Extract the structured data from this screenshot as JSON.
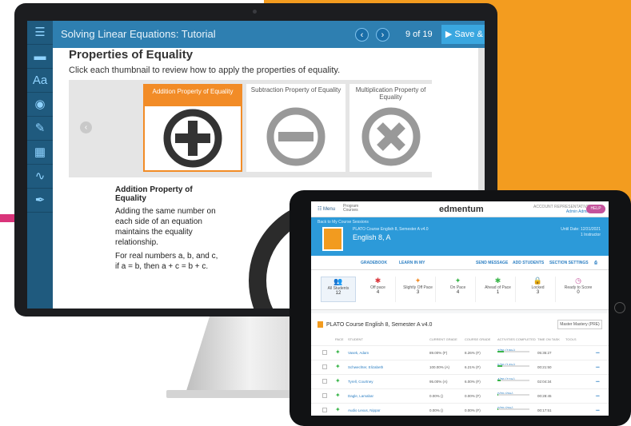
{
  "tutorial": {
    "title": "Solving Linear Equations: Tutorial",
    "page": "9 of 19",
    "save_label": "Save & Exit",
    "prev_icon": "‹",
    "next_icon": "›",
    "sidebar_icons": [
      "list-icon",
      "folder-icon",
      "dictionary-icon",
      "audio-icon",
      "notes-icon",
      "calculator-icon",
      "graph-icon",
      "pen-icon"
    ],
    "heading": "Properties of Equality",
    "instruction": "Click each thumbnail to review how to apply the properties of equality.",
    "thumbnails": [
      {
        "label": "Addition Property of Equality"
      },
      {
        "label": "Subtraction Property of Equality"
      },
      {
        "label": "Multiplication Property of Equality"
      }
    ],
    "sub_heading": "Addition Property of Equality",
    "para1": "Adding the same number on each side of an equation maintains the equality relationship.",
    "para2": "For real numbers a, b, and c, if a = b, then a + c = b + c.",
    "accent": "#f28c27",
    "primary": "#2e7fb1"
  },
  "dashboard": {
    "menu": "Menu",
    "crumb1": "Program",
    "crumb2": "Courses",
    "logo": "edmentum",
    "account1": "ACCOUNT REPRESENTATIVE",
    "account2": "Admin Admin",
    "help": "HELP",
    "back": "Back to My Course Sessions",
    "course_title": "PLATO Course English 8, Semester A v4.0",
    "course_name": "English 8, A",
    "dates1": "Until Date: 12/31/2021",
    "dates2": "1 Instructor",
    "actions": [
      "GRADEBOOK",
      "LEARN IN MY",
      "SEND MESSAGE",
      "ADD STUDENTS",
      "SECTION SETTINGS"
    ],
    "stats": [
      {
        "label": "All Students",
        "value": "12",
        "sym": "👥"
      },
      {
        "label": "Off pace",
        "value": "4",
        "sym": "✱"
      },
      {
        "label": "Slightly Off Pace",
        "value": "3",
        "sym": "✦"
      },
      {
        "label": "On Pace",
        "value": "4",
        "sym": "✦"
      },
      {
        "label": "Ahead of Pace",
        "value": "1",
        "sym": "✱"
      },
      {
        "label": "Locked",
        "value": "3",
        "sym": "🔒"
      },
      {
        "label": "Ready to Score",
        "value": "0",
        "sym": "◷"
      }
    ],
    "section_title": "PLATO Course English 8, Semester A v4.0",
    "mastery_btn": "Master Mastery (PRE)",
    "columns": [
      "PACE",
      "STUDENT",
      "CURRENT GRADE",
      "COURSE GRADE",
      "ACTIVITIES COMPLETED",
      "TIME ON TASK",
      "TOOLS"
    ],
    "rows": [
      {
        "name": "Vasek, Adam",
        "current": "89.00% (F)",
        "course": "8.26% (F)",
        "activities": "7/36 (19%)",
        "progress": 0.19,
        "time": "05:35:27"
      },
      {
        "name": "Schwechter, Elizabeth",
        "current": "100.00% (A)",
        "course": "6.21% (F)",
        "activities": "5/36 (14%)",
        "progress": 0.14,
        "time": "00:21:50"
      },
      {
        "name": "Tyrell, Courtney",
        "current": "95.00% (A)",
        "course": "6.00% (F)",
        "activities": "4/36 (11%)",
        "progress": 0.11,
        "time": "02:04:34"
      },
      {
        "name": "Dagle, Lamabar",
        "current": "0.00% ()",
        "course": "0.00% (F)",
        "activities": "0/25 (0%)",
        "progress": 0.0,
        "time": "00:28:45"
      },
      {
        "name": "Audio Lexus, Nippar",
        "current": "0.00% ()",
        "course": "0.00% (F)",
        "activities": "0/25 (0%)",
        "progress": 0.0,
        "time": "00:17:51"
      }
    ],
    "brand_color": "#2c9ad9"
  }
}
